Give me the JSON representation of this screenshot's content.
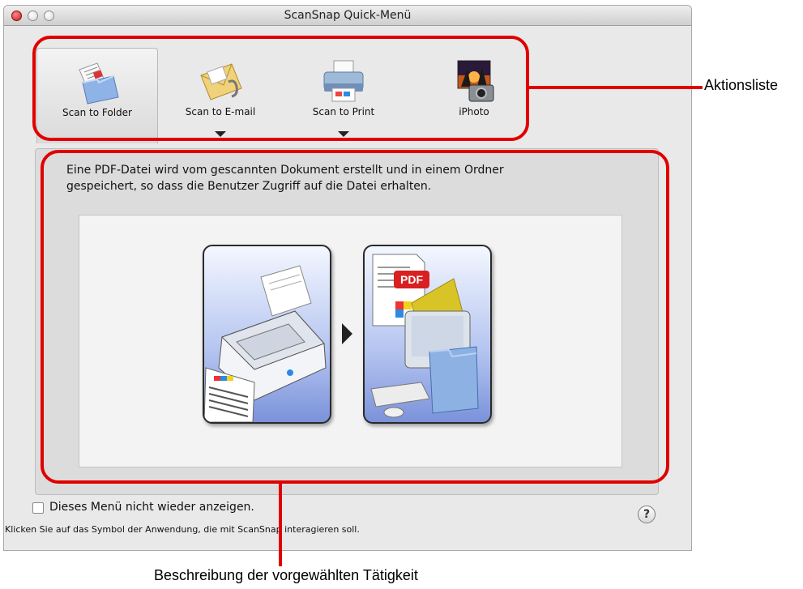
{
  "window": {
    "title": "ScanSnap Quick-Menü"
  },
  "actions": [
    {
      "label": "Scan to Folder",
      "icon": "folder-icon",
      "selected": true
    },
    {
      "label": "Scan to E-mail",
      "icon": "envelope-icon",
      "dropdown": true
    },
    {
      "label": "Scan to Print",
      "icon": "printer-icon",
      "dropdown": true
    },
    {
      "label": "iPhoto",
      "icon": "iphoto-icon"
    }
  ],
  "description": {
    "line1": "Eine PDF-Datei wird vom gescannten Dokument erstellt und in einem Ordner",
    "line2": "gespeichert, so dass die Benutzer Zugriff auf die Datei erhalten."
  },
  "illustration": {
    "badge": "PDF"
  },
  "footer": {
    "checkbox_label": "Dieses Menü nicht wieder anzeigen.",
    "checkbox_checked": false,
    "hint": "Klicken Sie auf das Symbol der Anwendung, die mit ScanSnap interagieren soll.",
    "help": "?"
  },
  "annotations": {
    "action_list": "Aktionsliste",
    "description": "Beschreibung der vorgewählten Tätigkeit"
  },
  "colors": {
    "annotation_red": "#e00000",
    "card_blue": "#7b92da"
  }
}
